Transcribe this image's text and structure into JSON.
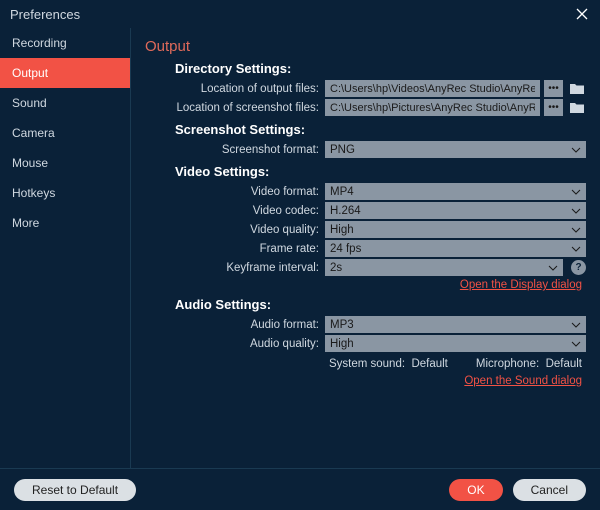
{
  "window": {
    "title": "Preferences"
  },
  "sidebar": {
    "items": [
      {
        "label": "Recording"
      },
      {
        "label": "Output"
      },
      {
        "label": "Sound"
      },
      {
        "label": "Camera"
      },
      {
        "label": "Mouse"
      },
      {
        "label": "Hotkeys"
      },
      {
        "label": "More"
      }
    ],
    "active_index": 1
  },
  "output": {
    "heading": "Output",
    "directory": {
      "title": "Directory Settings:",
      "output_label": "Location of output files:",
      "output_path": "C:\\Users\\hp\\Videos\\AnyRec Studio\\AnyRec Screen Recorder",
      "screenshot_label": "Location of screenshot files:",
      "screenshot_path": "C:\\Users\\hp\\Pictures\\AnyRec Studio\\AnyRec Screen Recorder"
    },
    "screenshot": {
      "title": "Screenshot Settings:",
      "format_label": "Screenshot format:",
      "format_value": "PNG"
    },
    "video": {
      "title": "Video Settings:",
      "format_label": "Video format:",
      "format_value": "MP4",
      "codec_label": "Video codec:",
      "codec_value": "H.264",
      "quality_label": "Video quality:",
      "quality_value": "High",
      "framerate_label": "Frame rate:",
      "framerate_value": "24 fps",
      "keyframe_label": "Keyframe interval:",
      "keyframe_value": "2s",
      "display_link": "Open the Display dialog"
    },
    "audio": {
      "title": "Audio Settings:",
      "format_label": "Audio format:",
      "format_value": "MP3",
      "quality_label": "Audio quality:",
      "quality_value": "High",
      "system_label": "System sound:",
      "system_value": "Default",
      "mic_label": "Microphone:",
      "mic_value": "Default",
      "sound_link": "Open the Sound dialog"
    }
  },
  "footer": {
    "reset": "Reset to Default",
    "ok": "OK",
    "cancel": "Cancel"
  },
  "icons": {
    "dots": "•••",
    "help": "?"
  }
}
